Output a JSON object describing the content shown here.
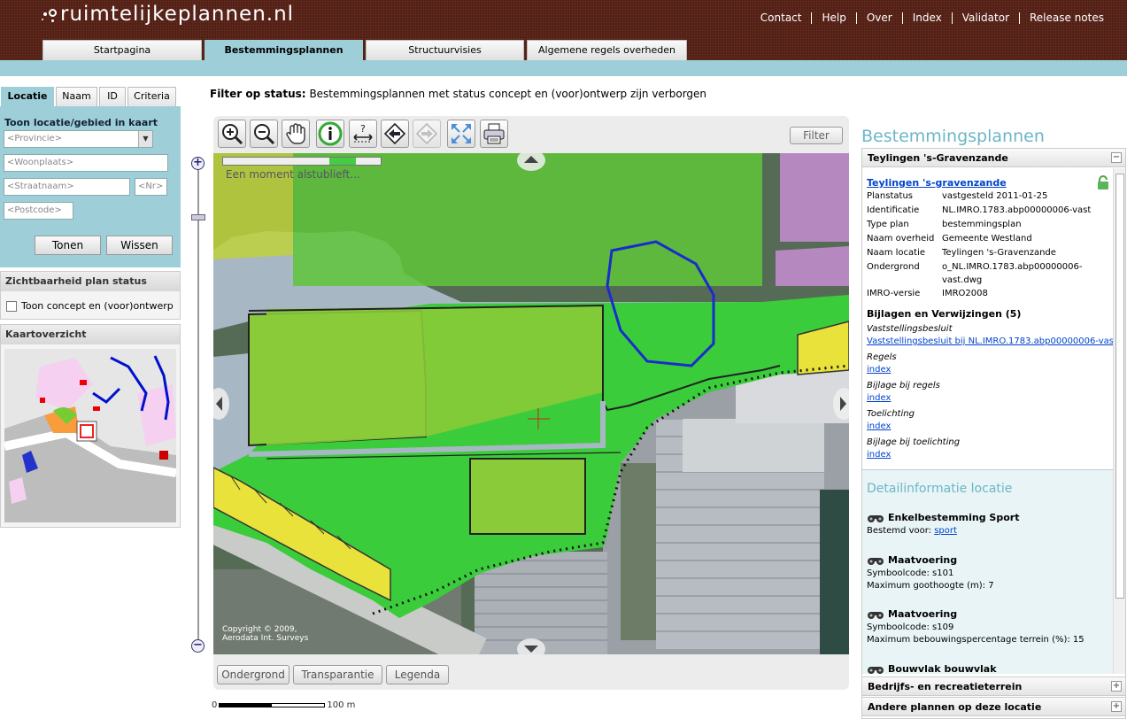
{
  "header": {
    "logo": "ruimtelijkeplannen.nl",
    "nav": [
      "Contact",
      "Help",
      "Over",
      "Index",
      "Validator",
      "Release notes"
    ],
    "tabs": [
      {
        "label": "Startpagina",
        "active": false
      },
      {
        "label": "Bestemmingsplannen",
        "active": true
      },
      {
        "label": "Structuurvisies",
        "active": false
      },
      {
        "label": "Algemene regels overheden",
        "active": false
      }
    ]
  },
  "left": {
    "tabs": [
      {
        "label": "Locatie",
        "active": true
      },
      {
        "label": "Naam",
        "active": false
      },
      {
        "label": "ID",
        "active": false
      },
      {
        "label": "Criteria",
        "active": false
      }
    ],
    "location_title": "Toon locatie/gebied in kaart",
    "province_placeholder": "<Provincie>",
    "city_placeholder": "<Woonplaats>",
    "street_placeholder": "<Straatnaam>",
    "nr_placeholder": "<Nr>",
    "postcode_placeholder": "<Postcode>",
    "show_button": "Tonen",
    "clear_button": "Wissen",
    "visibility_title": "Zichtbaarheid plan status",
    "concept_checkbox_label": "Toon concept en (voor)ontwerp",
    "overview_title": "Kaartoverzicht"
  },
  "filter": {
    "label": "Filter op status:",
    "text": "Bestemmingsplannen met status concept en (voor)ontwerp zijn verborgen"
  },
  "map": {
    "filter_button": "Filter",
    "loading_text": "Een moment alstublieft...",
    "copyright_line1": "Copyright © 2009,",
    "copyright_line2": "Aerodata Int. Surveys",
    "bottom_buttons": [
      "Ondergrond",
      "Transparantie",
      "Legenda"
    ],
    "scale_start": "0",
    "scale_end": "100 m",
    "tools": [
      "zoom-in-icon",
      "zoom-out-icon",
      "pan-hand-icon",
      "info-icon",
      "measure-icon",
      "back-icon",
      "forward-icon",
      "full-extent-icon",
      "print-icon"
    ]
  },
  "right": {
    "title": "Bestemmingsplannen",
    "plan_header": "Teylingen 's-Gravenzande",
    "plan_link": "Teylingen 's-gravenzande",
    "fields": [
      {
        "k": "Planstatus",
        "v": "vastgesteld 2011-01-25"
      },
      {
        "k": "Identificatie",
        "v": "NL.IMRO.1783.abp00000006-vast"
      },
      {
        "k": "Type plan",
        "v": "bestemmingsplan"
      },
      {
        "k": "Naam overheid",
        "v": "Gemeente Westland"
      },
      {
        "k": "Naam locatie",
        "v": "Teylingen 's-Gravenzande"
      },
      {
        "k": "Ondergrond",
        "v": "o_NL.IMRO.1783.abp00000006-vast.dwg"
      },
      {
        "k": "IMRO-versie",
        "v": "IMRO2008"
      }
    ],
    "attachments_title": "Bijlagen en Verwijzingen (5)",
    "attachments": [
      {
        "label": "Vaststellingsbesluit",
        "link": "Vaststellingsbesluit bij NL.IMRO.1783.abp00000006-vast"
      },
      {
        "label": "Regels",
        "link": "index"
      },
      {
        "label": "Bijlage bij regels",
        "link": "index"
      },
      {
        "label": "Toelichting",
        "link": "index"
      },
      {
        "label": "Bijlage bij toelichting",
        "link": "index"
      }
    ],
    "detail_title": "Detailinformatie locatie",
    "details": [
      {
        "head": "Enkelbestemming Sport",
        "line1_label": "Bestemd voor: ",
        "line1_link": "sport",
        "line2": ""
      },
      {
        "head": "Maatvoering",
        "line1": "Symboolcode: s101",
        "line2": "Maximum goothoogte (m): 7"
      },
      {
        "head": "Maatvoering",
        "line1": "Symboolcode: s109",
        "line2": "Maximum bebouwingspercentage terrein (%): 15"
      },
      {
        "head": "Bouwvlak bouwvlak",
        "line1": "",
        "line2": ""
      }
    ],
    "collapsed_sections": [
      "Bedrijfs- en recreatieterrein",
      "Andere plannen op deze locatie"
    ]
  }
}
